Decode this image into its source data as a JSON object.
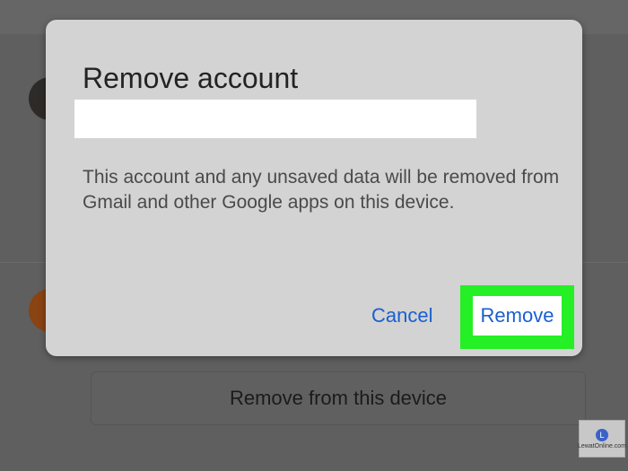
{
  "dialog": {
    "title": "Remove account",
    "message": "This account and any unsaved data will be removed from Gmail and other Google apps on this device.",
    "cancel_label": "Cancel",
    "remove_label": "Remove"
  },
  "background": {
    "remove_device_label": "Remove from this device"
  },
  "watermark": {
    "text": "LewatOnline.com",
    "logo_letter": "L"
  },
  "colors": {
    "accent": "#1a5fd0",
    "highlight": "#25ef25",
    "dialog_bg": "#d3d3d3",
    "scrim": "#5f5f5f"
  }
}
